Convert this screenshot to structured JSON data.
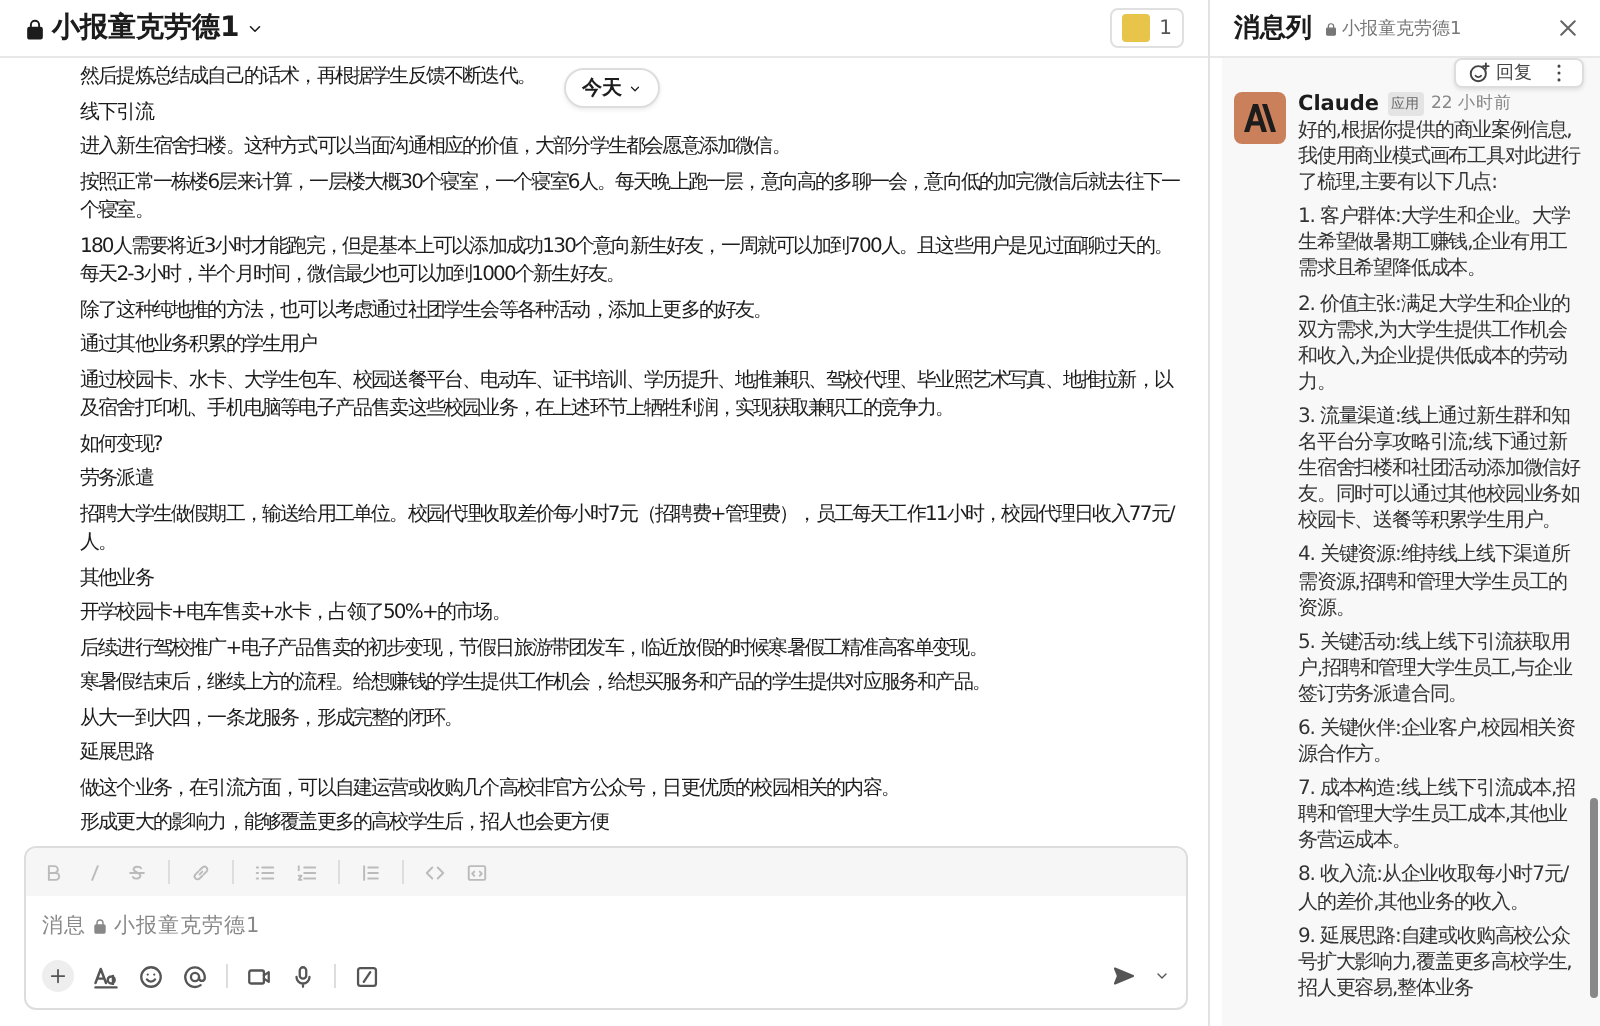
{
  "channel_header": {
    "lock": true,
    "title": "小报童克劳德1",
    "member_count": "1"
  },
  "date_divider": "今天",
  "messages": [
    "然后提炼总结成自己的话术，再根据学生反馈不断迭代。",
    "线下引流",
    "进入新生宿舍扫楼。这种方式可以当面沟通相应的价值，大部分学生都会愿意添加微信。",
    "按照正常一栋楼6层来计算，一层楼大概30个寝室，一个寝室6人。每天晚上跑一层，意向高的多聊一会，意向低的加完微信后就去往下一个寝室。",
    "180人需要将近3小时才能跑完，但是基本上可以添加成功130个意向新生好友，一周就可以加到700人。且这些用户是见过面聊过天的。每天2-3小时，半个月时间，微信最少也可以加到1000个新生好友。",
    "除了这种纯地推的方法，也可以考虑通过社团学生会等各种活动，添加上更多的好友。",
    "通过其他业务积累的学生用户",
    "通过校园卡、水卡、大学生包车、校园送餐平台、电动车、证书培训、学历提升、地推兼职、驾校代理、毕业照艺术写真、地推拉新，以及宿舍打印机、手机电脑等电子产品售卖这些校园业务，在上述环节上牺牲利润，实现获取兼职工的竞争力。",
    "如何变现?",
    "劳务派遣",
    "招聘大学生做假期工，输送给用工单位。校园代理收取差价每小时7元（招聘费+管理费），员工每天工作11小时，校园代理日收入77元/人。",
    "其他业务",
    "开学校园卡+电车售卖+水卡，占领了50%+的市场。",
    "后续进行驾校推广+电子产品售卖的初步变现，节假日旅游带团发车，临近放假的时候寒暑假工精准高客单变现。",
    "寒暑假结束后，继续上方的流程。给想赚钱的学生提供工作机会，给想买服务和产品的学生提供对应服务和产品。",
    "从大一到大四，一条龙服务，形成完整的闭环。",
    "延展思路",
    "做这个业务，在引流方面，可以自建运营或收购几个高校非官方公众号，日更优质的校园相关的内容。",
    "形成更大的影响力，能够覆盖更多的高校学生后，招人也会更方便"
  ],
  "composer": {
    "placeholder": "消息",
    "channel": "小报童克劳德1"
  },
  "thread": {
    "title": "消息列",
    "channel": "小报童克劳德1",
    "author": "Claude",
    "badge": "应用",
    "time": "22 小时前",
    "reply_label": "回复",
    "paragraphs": [
      "好的,根据你提供的商业案例信息,我使用商业模式画布工具对此进行了梳理,主要有以下几点:",
      "1. 客户群体:大学生和企业。大学生希望做暑期工赚钱,企业有用工需求且希望降低成本。",
      "2. 价值主张:满足大学生和企业的双方需求,为大学生提供工作机会和收入,为企业提供低成本的劳动力。",
      "3. 流量渠道:线上通过新生群和知名平台分享攻略引流;线下通过新生宿舍扫楼和社团活动添加微信好友。同时可以通过其他校园业务如校园卡、送餐等积累学生用户。",
      "4. 关键资源:维持线上线下渠道所需资源,招聘和管理大学生员工的资源。",
      "5. 关键活动:线上线下引流获取用户,招聘和管理大学生员工,与企业签订劳务派遣合同。",
      "6. 关键伙伴:企业客户,校园相关资源合作方。",
      "7. 成本构造:线上线下引流成本,招聘和管理大学生员工成本,其他业务营运成本。",
      "8. 收入流:从企业收取每小时7元/人的差价,其他业务的收入。",
      "9. 延展思路:自建或收购高校公众号扩大影响力,覆盖更多高校学生,招人更容易,整体业务"
    ]
  }
}
